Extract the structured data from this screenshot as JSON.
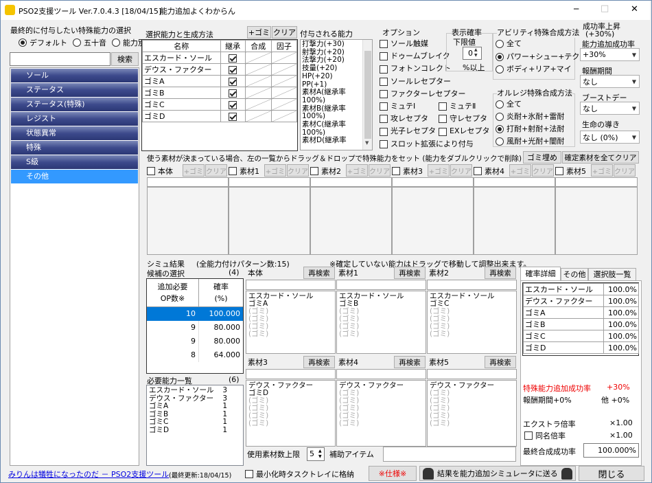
{
  "window": {
    "title": "PSO2支援ツール Ver.7.0.4.3 [18/04/15]",
    "subtitle": "能力追加よくわからん",
    "minimize": "─",
    "maximize": "□",
    "close": "✕"
  },
  "left": {
    "heading": "最終的に付与したい特殊能力の選択",
    "radios": [
      {
        "label": "デフォルト",
        "checked": true
      },
      {
        "label": "五十音",
        "checked": false
      },
      {
        "label": "能力別",
        "checked": false
      }
    ],
    "search_value": "",
    "search_button": "検索",
    "categories": [
      "ソール",
      "ステータス",
      "ステータス(特殊)",
      "レジスト",
      "状態異常",
      "特殊",
      "S級",
      "その他"
    ],
    "selected_category": 7
  },
  "selection": {
    "heading": "選択能力と生成方法",
    "add_trash": "+ゴミ",
    "clear": "クリア",
    "columns": [
      "名称",
      "継承",
      "合成",
      "因子"
    ],
    "rows": [
      "エスカード・ソール",
      "デウス・ファクター",
      "ゴミA",
      "ゴミB",
      "ゴミC",
      "ゴミD"
    ]
  },
  "granted": {
    "heading": "付与される能力",
    "items": [
      "打撃力(+30)",
      "射撃力(+20)",
      "法撃力(+20)",
      "技量(+20)",
      "HP(+20)",
      "PP(+1)",
      "素材A(継承率",
      "100%)",
      "素材B(継承率",
      "100%)",
      "素材C(継承率",
      "100%)",
      "素材D(継承率"
    ]
  },
  "options": {
    "heading": "オプション",
    "items": [
      "ソール触媒",
      "ドゥームブレイク",
      "フォトンコレクト",
      "ソールレセプター",
      "ファクターレセプター"
    ],
    "pairs": [
      [
        "ミュテⅠ",
        "ミュテⅡ"
      ],
      [
        "攻レセプタ",
        "守レセプタ"
      ],
      [
        "光子レセプタ",
        "EXレセプタ"
      ]
    ],
    "slot_ext": "スロット拡張により付与"
  },
  "rate": {
    "heading": "表示確率",
    "sub": "下限値",
    "value": "0",
    "suffix": "%以上"
  },
  "ability": {
    "heading": "アビリティ特殊合成方法",
    "options": [
      {
        "label": "全て",
        "checked": false
      },
      {
        "label": "パワー+シュー+テク",
        "checked": true
      },
      {
        "label": "ボディ+リア+マイ",
        "checked": false
      }
    ]
  },
  "orulle": {
    "heading": "オルレジ特殊合成方法",
    "options": [
      {
        "label": "全て",
        "checked": false
      },
      {
        "label": "炎耐+氷耐+雷耐",
        "checked": false
      },
      {
        "label": "打耐+射耐+法耐",
        "checked": true
      },
      {
        "label": "風耐+光耐+闇耐",
        "checked": false
      }
    ]
  },
  "right": {
    "success_up": "成功率上昇",
    "success_up2": "(+30%)",
    "add_success_label": "能力追加成功率",
    "add_success_value": "+30%",
    "reward_label": "報酬期間",
    "reward_value": "なし",
    "boost_label": "ブーストデー",
    "boost_value": "なし",
    "guide_label": "生命の導き",
    "guide_value": "なし (0%)"
  },
  "materials": {
    "instruction": "使う素材が決まっている場合、左の一覧からドラッグ＆ドロップで特殊能力をセット (能力をダブルクリックで削除)",
    "trash_fill": "ゴミ埋め",
    "clear_all": "確定素材を全てクリア",
    "add_trash": "+ゴミ",
    "clear": "クリア",
    "slots": [
      "本体",
      "素材1",
      "素材2",
      "素材3",
      "素材4",
      "素材5"
    ]
  },
  "sim": {
    "heading": "シミュ結果",
    "pattern_label": "(全能力付けパターン数:",
    "pattern_count": "15",
    "pattern_close": ")",
    "note": "※確定していない能力はドラッグで移動して調整出来ます。",
    "candidates_label": "候補の選択",
    "candidates_count": "(4)",
    "col1a": "追加必要",
    "col1b": "OP数※",
    "col2a": "確率",
    "col2b": "(%)",
    "rows": [
      {
        "op": "10",
        "rate": "100.000",
        "selected": true
      },
      {
        "op": "9",
        "rate": "80.000",
        "selected": false
      },
      {
        "op": "9",
        "rate": "80.000",
        "selected": false
      },
      {
        "op": "8",
        "rate": "64.000",
        "selected": false
      }
    ],
    "need_label": "必要能力一覧",
    "need_count": "(6)",
    "need": [
      {
        "name": "エスカード・ソール",
        "n": "3"
      },
      {
        "name": "デウス・ファクター",
        "n": "3"
      },
      {
        "name": "ゴミA",
        "n": "1"
      },
      {
        "name": "ゴミB",
        "n": "1"
      },
      {
        "name": "ゴミC",
        "n": "1"
      },
      {
        "name": "ゴミD",
        "n": "1"
      }
    ],
    "research": "再検索",
    "slots": [
      {
        "name": "本体",
        "items": [
          "エスカード・ソール",
          "ゴミA"
        ],
        "empty": 4
      },
      {
        "name": "素材1",
        "items": [
          "エスカード・ソール",
          "ゴミB"
        ],
        "empty": 4
      },
      {
        "name": "素材2",
        "items": [
          "エスカード・ソール",
          "ゴミC"
        ],
        "empty": 4
      },
      {
        "name": "素材3",
        "items": [
          "デウス・ファクター",
          "ゴミD"
        ],
        "empty": 4
      },
      {
        "name": "素材4",
        "items": [
          "デウス・ファクター"
        ],
        "empty": 5
      },
      {
        "name": "素材5",
        "items": [
          "デウス・ファクター"
        ],
        "empty": 5
      }
    ],
    "empty_text": "(ゴミ)",
    "use_limit_label": "使用素材数上限",
    "use_limit_value": "5",
    "aux_item": "補助アイテム"
  },
  "detail": {
    "tabs": [
      "確率詳細",
      "その他",
      "選択肢一覧"
    ],
    "rows": [
      {
        "name": "エスカード・ソール",
        "p": "100.0%"
      },
      {
        "name": "デウス・ファクター",
        "p": "100.0%"
      },
      {
        "name": "ゴミA",
        "p": "100.0%"
      },
      {
        "name": "ゴミB",
        "p": "100.0%"
      },
      {
        "name": "ゴミC",
        "p": "100.0%"
      },
      {
        "name": "ゴミD",
        "p": "100.0%"
      }
    ],
    "special_label": "特殊能力追加成功率",
    "special_value": "+30%",
    "reward": "報酬期間+0%",
    "other": "他 +0%",
    "extra_label": "エクストラ倍率",
    "extra_value": "×1.00",
    "same_label": "同名倍率",
    "same_value": "×1.00",
    "final_label": "最終合成成功率",
    "final_value": "100.000%"
  },
  "footer": {
    "link": "みりんは犠牲になったのだ － PSO2支援ツール",
    "updated": "(最終更新:18/04/15)",
    "tray": "最小化時タスクトレイに格納",
    "spec": "※仕様※",
    "send": "結果を能力追加シミュレータに送る",
    "close": "閉じる"
  }
}
